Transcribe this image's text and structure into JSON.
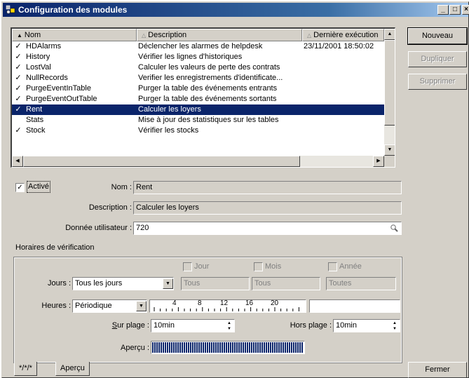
{
  "window": {
    "title": "Configuration des modules",
    "controls": [
      "_",
      "□",
      "×"
    ]
  },
  "list": {
    "columns": [
      {
        "label": "Nom",
        "sort": "▲"
      },
      {
        "label": "Description",
        "sort": "△"
      },
      {
        "label": "Dernière exécution",
        "sort": "△"
      }
    ],
    "rows": [
      {
        "checked": "✓",
        "nom": "HDAlarms",
        "description": "Déclencher les alarmes de helpdesk",
        "last_run": "23/11/2001 18:50:02",
        "selected": false
      },
      {
        "checked": "✓",
        "nom": "History",
        "description": "Vérifier les lignes d'historiques",
        "last_run": "",
        "selected": false
      },
      {
        "checked": "✓",
        "nom": "LostVal",
        "description": "Calculer les valeurs de perte des contrats",
        "last_run": "",
        "selected": false
      },
      {
        "checked": "✓",
        "nom": "NullRecords",
        "description": "Verifier les enregistrements d'identificate...",
        "last_run": "",
        "selected": false
      },
      {
        "checked": "✓",
        "nom": "PurgeEventInTable",
        "description": "Purger la table des événements entrants",
        "last_run": "",
        "selected": false
      },
      {
        "checked": "✓",
        "nom": "PurgeEventOutTable",
        "description": "Purger la table des événements sortants",
        "last_run": "",
        "selected": false
      },
      {
        "checked": "✓",
        "nom": "Rent",
        "description": "Calculer les loyers",
        "last_run": "",
        "selected": true
      },
      {
        "checked": "",
        "nom": "Stats",
        "description": "Mise à jour des statistiques sur les tables",
        "last_run": "",
        "selected": false
      },
      {
        "checked": "✓",
        "nom": "Stock",
        "description": "Vérifier les stocks",
        "last_run": "",
        "selected": false
      }
    ]
  },
  "buttons": {
    "nouveau": "Nouveau",
    "dupliquer": "Dupliquer",
    "supprimer": "Supprimer",
    "fermer": "Fermer"
  },
  "details": {
    "active_label": "Activé",
    "active_checked": "✓",
    "nom_label": "Nom :",
    "nom_value": "Rent",
    "description_label": "Description :",
    "description_value": "Calculer les loyers",
    "user_data_label": "Donnée utilisateur :",
    "user_data_value": "720"
  },
  "schedule": {
    "heading": "Horaires de vérification",
    "jour_label": "Jour",
    "mois_label": "Mois",
    "annee_label": "Année",
    "jours_label": "Jours :",
    "jours_value": "Tous les jours",
    "jour_value": "Tous",
    "mois_value": "Tous",
    "annee_value": "Toutes",
    "heures_label": "Heures :",
    "heures_value": "Périodique",
    "ruler_ticks": [
      "4",
      "8",
      "12",
      "16",
      "20"
    ],
    "sur_plage_label": "Sur plage :",
    "sur_plage_value": "10min",
    "hors_plage_label": "Hors plage :",
    "hors_plage_value": "10min",
    "apercu_label": "Aperçu :",
    "apercu_color": "#0a246a"
  },
  "tabs": [
    "*/*/*",
    "Aperçu"
  ]
}
